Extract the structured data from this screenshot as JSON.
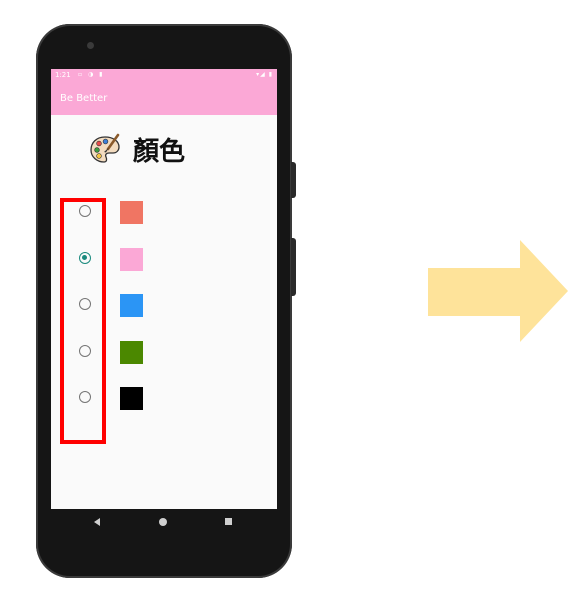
{
  "status_bar": {
    "time": "1:21",
    "left_icons": "▫ ◑ ▮",
    "right_icons": "▾◢ ▮"
  },
  "app_bar": {
    "title": "Be Better"
  },
  "heading": {
    "icon": "artist-palette-icon",
    "label": "顏色"
  },
  "color_options": [
    {
      "color": "#f07563",
      "selected": false
    },
    {
      "color": "#fba8d6",
      "selected": true
    },
    {
      "color": "#2b95f5",
      "selected": false
    },
    {
      "color": "#4b8800",
      "selected": false
    },
    {
      "color": "#000000",
      "selected": false
    }
  ],
  "radio_accent_color": "#1a8a7e",
  "highlight_color": "#ff0000",
  "arrow_color": "#fee39a",
  "nav_bar": {
    "icons": [
      "back-icon",
      "home-icon",
      "recents-icon"
    ]
  }
}
